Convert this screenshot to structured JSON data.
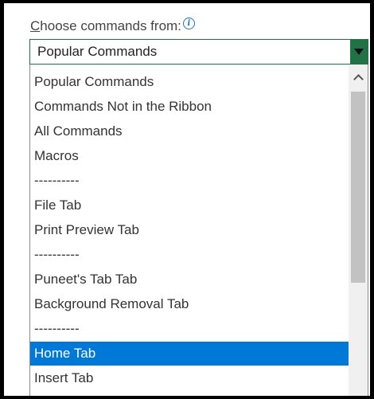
{
  "label": {
    "underlined_char": "C",
    "rest": "hoose commands from:",
    "icon": "info-icon",
    "icon_glyph": "i"
  },
  "combo": {
    "selected_value": "Popular Commands",
    "icon": "dropdown-arrow-icon"
  },
  "list": {
    "items": [
      {
        "label": "Popular Commands"
      },
      {
        "label": "Commands Not in the Ribbon"
      },
      {
        "label": "All Commands"
      },
      {
        "label": "Macros"
      },
      {
        "label": "----------"
      },
      {
        "label": "File Tab"
      },
      {
        "label": "Print Preview Tab"
      },
      {
        "label": "----------"
      },
      {
        "label": "Puneet's Tab Tab"
      },
      {
        "label": "Background Removal Tab"
      },
      {
        "label": "----------"
      },
      {
        "label": "Home Tab",
        "selected": true
      },
      {
        "label": "Insert Tab"
      }
    ]
  },
  "colors": {
    "accent_green": "#217346",
    "selection_blue": "#0078d7"
  }
}
